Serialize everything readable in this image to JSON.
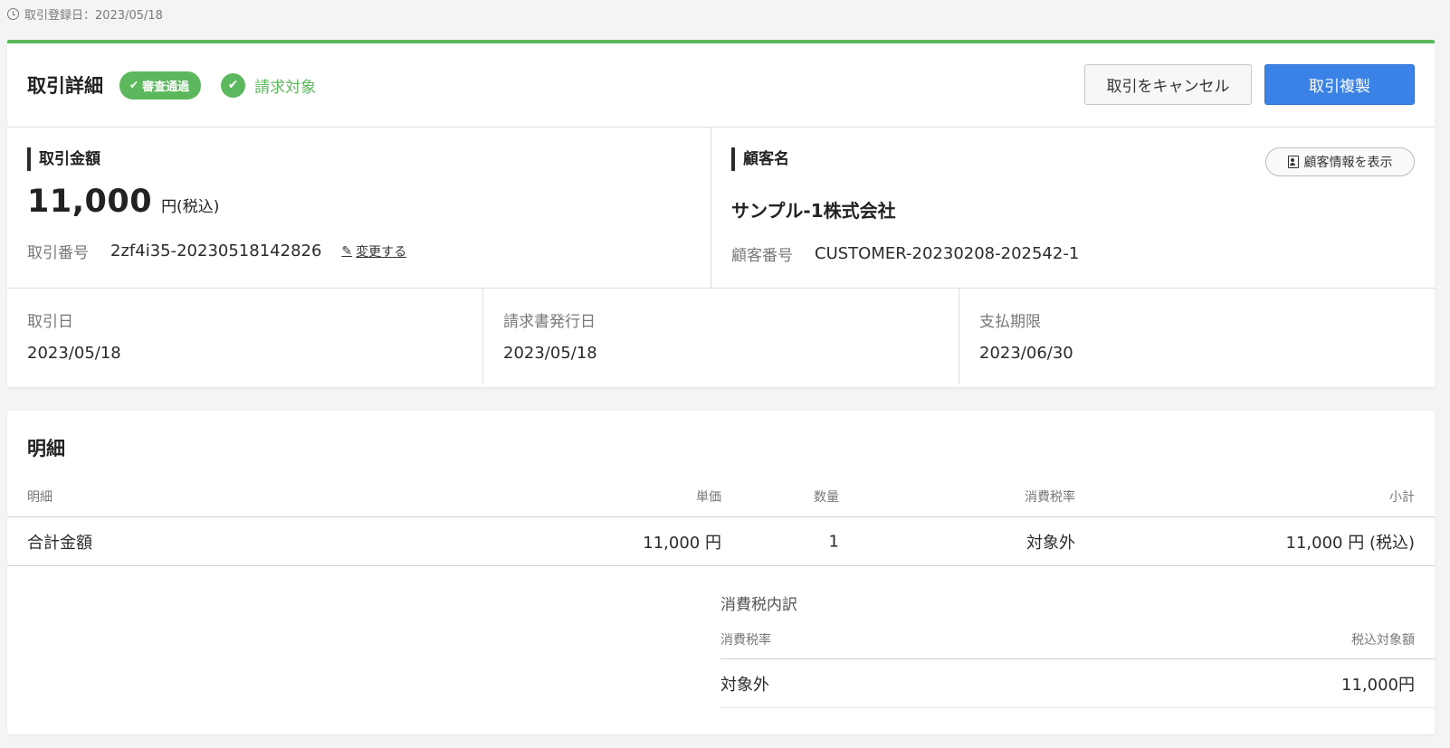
{
  "header": {
    "registered_label": "取引登録日：2023/05/18"
  },
  "detail": {
    "title": "取引詳細",
    "badge_approved": "審査通過",
    "billing_status": "請求対象",
    "cancel_button": "取引をキャンセル",
    "duplicate_button": "取引複製",
    "amount": {
      "label": "取引金額",
      "value": "11,000",
      "unit": "円(税込)",
      "number_key": "取引番号",
      "number_value": "2zf4i35-20230518142826",
      "edit_link": "変更する"
    },
    "customer": {
      "label": "顧客名",
      "info_button": "顧客情報を表示",
      "name": "サンプル-1株式会社",
      "number_key": "顧客番号",
      "number_value": "CUSTOMER-20230208-202542-1"
    },
    "dates": [
      {
        "label": "取引日",
        "value": "2023/05/18"
      },
      {
        "label": "請求書発行日",
        "value": "2023/05/18"
      },
      {
        "label": "支払期限",
        "value": "2023/06/30"
      }
    ]
  },
  "items": {
    "title": "明細",
    "columns": {
      "desc": "明細",
      "price": "単価",
      "qty": "数量",
      "tax": "消費税率",
      "subtotal": "小計"
    },
    "rows": [
      {
        "desc": "合計金額",
        "price": "11,000 円",
        "qty": "1",
        "tax": "対象外",
        "subtotal": "11,000 円 (税込)"
      }
    ],
    "tax_breakdown": {
      "title": "消費税内訳",
      "col_rate": "消費税率",
      "col_amount": "税込対象額",
      "rows": [
        {
          "rate": "対象外",
          "amount": "11,000円"
        }
      ]
    }
  },
  "colors": {
    "accent_green": "#5cb85c",
    "primary_blue": "#3b82e6"
  },
  "icons": {
    "clock": "clock-icon",
    "check": "check-icon",
    "pencil": "pencil-icon",
    "contact": "contact-card-icon"
  }
}
